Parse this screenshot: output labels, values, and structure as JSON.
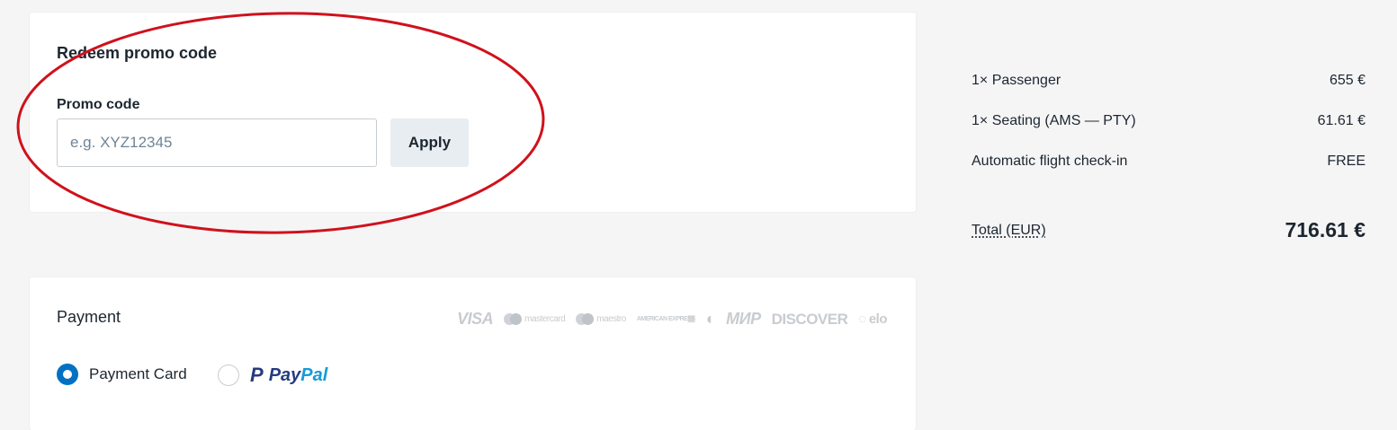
{
  "promo": {
    "title": "Redeem promo code",
    "field_label": "Promo code",
    "placeholder": "e.g. XYZ12345",
    "value": "",
    "apply_label": "Apply"
  },
  "payment": {
    "title": "Payment",
    "card_logos": [
      "VISA",
      "mastercard",
      "maestro",
      "AMERICAN EXPRESS",
      "JCB",
      "Diners",
      "МИР",
      "DISCOVER",
      "elo"
    ],
    "options": [
      {
        "label": "Payment Card",
        "selected": true
      },
      {
        "label": "PayPal",
        "selected": false
      }
    ],
    "paypal": {
      "pay": "Pay",
      "pal": "Pal",
      "mark": "P"
    }
  },
  "summary": {
    "rows": [
      {
        "label": "1× Passenger",
        "value": "655 €"
      },
      {
        "label": "1× Seating (AMS — PTY)",
        "value": "61.61 €"
      },
      {
        "label": "Automatic flight check-in",
        "value": "FREE"
      }
    ],
    "total_label": "Total (EUR)",
    "total_value": "716.61 €"
  },
  "colors": {
    "accent": "#0071c3",
    "annotation": "#d0111c",
    "background": "#f5f5f6"
  }
}
